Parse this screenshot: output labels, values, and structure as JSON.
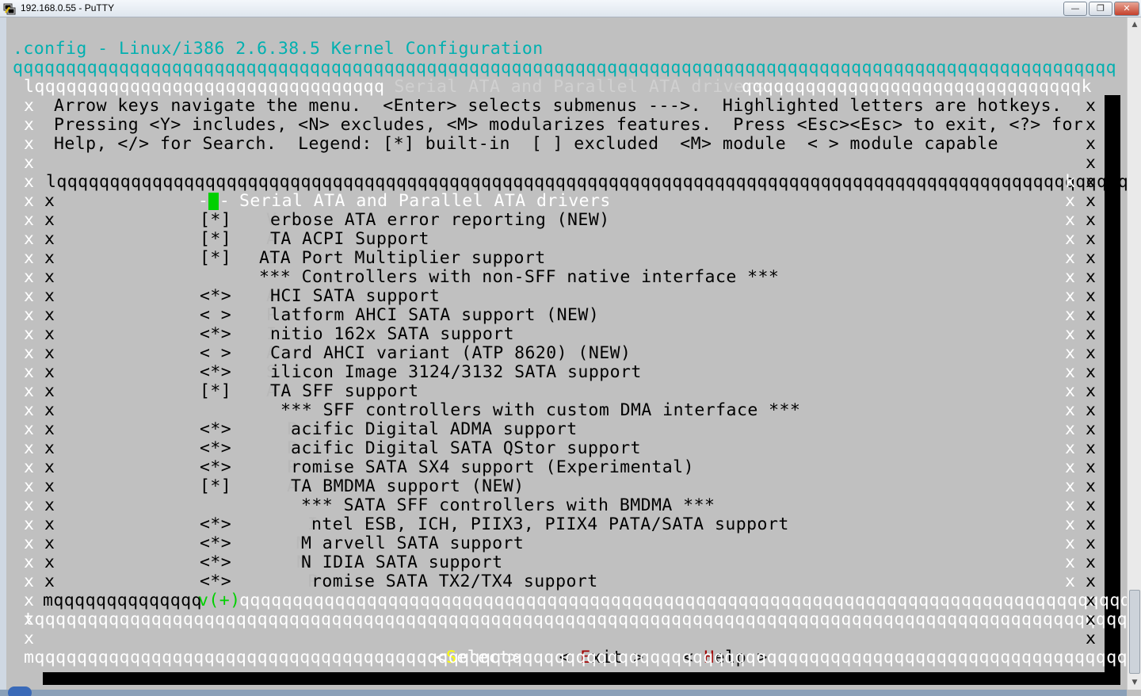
{
  "window": {
    "title": "192.168.0.55 - PuTTY",
    "min_label": "—",
    "max_label": "❐",
    "close_label": "✕"
  },
  "screen": {
    "title": ".config - Linux/i386 2.6.38.5 Kernel Configuration",
    "top_rule": "qqqqqqqqqqqqqqqqqqqqqqqqqqqqqqqqqqqqqqqqqqqqqqqqqqqqqqqqqqqqqqqqqqqqqqqqqqqqqqqqqqqqqqqqqqqqqqqqqqqqqqqq"
  },
  "dialog": {
    "top_border_left": "lqqqqqqqqqqqqqqqqqqqqqqqqqqqqqqqqq",
    "top_border_title": " Serial ATA and Parallel ATA drivers ",
    "top_border_right": "qqqqqqqqqqqqqqqqqqqqqqqqqqqqqqqqk",
    "help_lines": [
      "Arrow keys navigate the menu.  <Enter> selects submenus --->.  Highlighted letters are hotkeys.",
      "Pressing <Y> includes, <N> excludes, <M> modularizes features.  Press <Esc><Esc> to exit, <?> for",
      "Help, </> for Search.  Legend: [*] built-in  [ ] excluded  <M> module  < > module capable"
    ],
    "list_top_border": "lqqqqqqqqqqqqqqqqqqqqqqqqqqqqqqqqqqqqqqqqqqqqqqqqqqqqqqqqqqqqqqqqqqqqqqqqqqqqqqqqqqqqqqqqqqqqqqqqqqqqq",
    "list_top_corner": "k",
    "list_bottom_left": "mqqqqqqqqqqqqqq",
    "list_bottom_more": "v(+)",
    "list_bottom_right": "qqqqqqqqqqqqqqqqqqqqqqqqqqqqqqqqqqqqqqqqqqqqqqqqqqqqqqqqqqqqqqqqqqqqqqqqqqqqqqqqqqqqqqqj",
    "separator": "tqqqqqqqqqqqqqqqqqqqqqqqqqqqqqqqqqqqqqqqqqqqqqqqqqqqqqqqqqqqqqqqqqqqqqqqqqqqqqqqqqqqqqqqqqqqqqqqqqqqqqqqqqu",
    "bottom_border": "mqqqqqqqqqqqqqqqqqqqqqqqqqqqqqqqqqqqqqqqqqqqqqqqqqqqqqqqqqqqqqqqqqqqqqqqqqqqqqqqqqqqqqqqqqqqqqqqqqqqqqqqqqj",
    "side_char": "x"
  },
  "menu": {
    "selected_prefix": "---",
    "selected_label": "Serial ATA and Parallel ATA drivers",
    "items": [
      {
        "marker": "[*]",
        "ghost": "V",
        "text": "erbose ATA error reporting (NEW)"
      },
      {
        "marker": "[*]",
        "ghost": "A",
        "text": "TA ACPI Support"
      },
      {
        "marker": "[*]",
        "ghost": "S",
        "text": "ATA Port Multiplier support"
      },
      {
        "marker": "",
        "ghost": "",
        "text": "*** Controllers with non-SFF native interface ***"
      },
      {
        "marker": "<*>",
        "ghost": "A",
        "text": "HCI SATA support"
      },
      {
        "marker": "< >",
        "ghost": "P",
        "text": "latform AHCI SATA support (NEW)"
      },
      {
        "marker": "<*>",
        "ghost": "I",
        "text": "nitio 162x SATA support"
      },
      {
        "marker": "< >",
        "ghost": "A",
        "text": "Card AHCI variant (ATP 8620) (NEW)"
      },
      {
        "marker": "<*>",
        "ghost": "S",
        "text": "ilicon Image 3124/3132 SATA support"
      },
      {
        "marker": "[*]",
        "ghost": "A",
        "text": "TA SFF support"
      },
      {
        "marker": "",
        "ghost": "",
        "text": "*** SFF controllers with custom DMA interface ***"
      },
      {
        "marker": "<*>",
        "ghost": "P",
        "text": "acific Digital ADMA support"
      },
      {
        "marker": "<*>",
        "ghost": "P",
        "text": "acific Digital SATA QStor support"
      },
      {
        "marker": "<*>",
        "ghost": "P",
        "text": "romise SATA SX4 support (Experimental)"
      },
      {
        "marker": "[*]",
        "ghost": "A",
        "text": "TA BMDMA support (NEW)"
      },
      {
        "marker": "",
        "ghost": "",
        "text": "*** SATA SFF controllers with BMDMA ***"
      },
      {
        "marker": "<*>",
        "ghost": "I",
        "text": "ntel ESB, ICH, PIIX3, PIIX4 PATA/SATA support"
      },
      {
        "marker": "<*>",
        "ghost": "M",
        "text": "M arvell SATA support"
      },
      {
        "marker": "<*>",
        "ghost": "N",
        "text": "N IDIA SATA support"
      },
      {
        "marker": "<*>",
        "ghost": "P",
        "text": "romise SATA TX2/TX4 support"
      }
    ]
  },
  "buttons": {
    "select": {
      "left": "<",
      "hot": "S",
      "rest": "elect",
      "right": ">"
    },
    "exit": {
      "left": "< ",
      "hot": "E",
      "rest": "xit",
      "right": " >"
    },
    "help": {
      "left": "< ",
      "hot": "H",
      "rest": "elp",
      "right": " >"
    }
  },
  "colors": {
    "screen_bg": "#c0c0c0",
    "title_cyan": "#00b0b0",
    "hotkey_yellow": "#ffff00",
    "hotkey_red": "#a00000",
    "cursor_green": "#00d000"
  }
}
